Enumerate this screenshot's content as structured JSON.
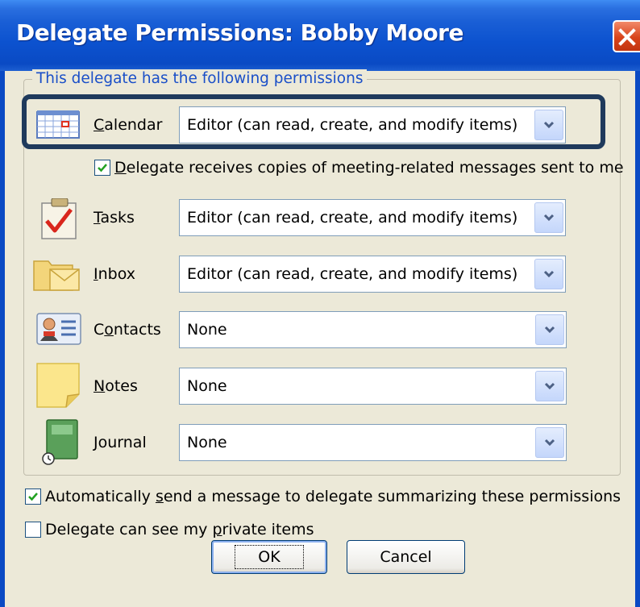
{
  "window": {
    "title": "Delegate Permissions: Bobby Moore"
  },
  "group": {
    "legend": "This delegate has the following permissions"
  },
  "permissions": [
    {
      "pre": "",
      "key": "C",
      "post": "alendar",
      "value": "Editor (can read, create, and modify items)",
      "icon": "calendar-icon"
    },
    {
      "pre": "",
      "key": "T",
      "post": "asks",
      "value": "Editor (can read, create, and modify items)",
      "icon": "tasks-icon"
    },
    {
      "pre": "",
      "key": "I",
      "post": "nbox",
      "value": "Editor (can read, create, and modify items)",
      "icon": "inbox-icon"
    },
    {
      "pre": "C",
      "key": "o",
      "post": "ntacts",
      "value": "None",
      "icon": "contacts-icon"
    },
    {
      "pre": "",
      "key": "N",
      "post": "otes",
      "value": "None",
      "icon": "notes-icon"
    },
    {
      "pre": "",
      "key": "J",
      "post": "ournal",
      "value": "None",
      "icon": "journal-icon"
    }
  ],
  "meeting_copies": {
    "key": "D",
    "rest": "elegate receives copies of meeting-related messages sent to me",
    "checked": true
  },
  "auto_send": {
    "pre": "Automatically ",
    "key": "s",
    "post": "end a message to delegate summarizing these permissions",
    "checked": true
  },
  "private_items": {
    "pre": "Delegate can see my ",
    "key": "p",
    "post": "rivate items",
    "checked": false
  },
  "buttons": {
    "ok": "OK",
    "cancel": "Cancel"
  },
  "colors": {
    "titlebar": "#0a4ac4",
    "legend_text": "#1a4fc8",
    "highlight": "#1f3a5c",
    "close": "#d8431a"
  }
}
